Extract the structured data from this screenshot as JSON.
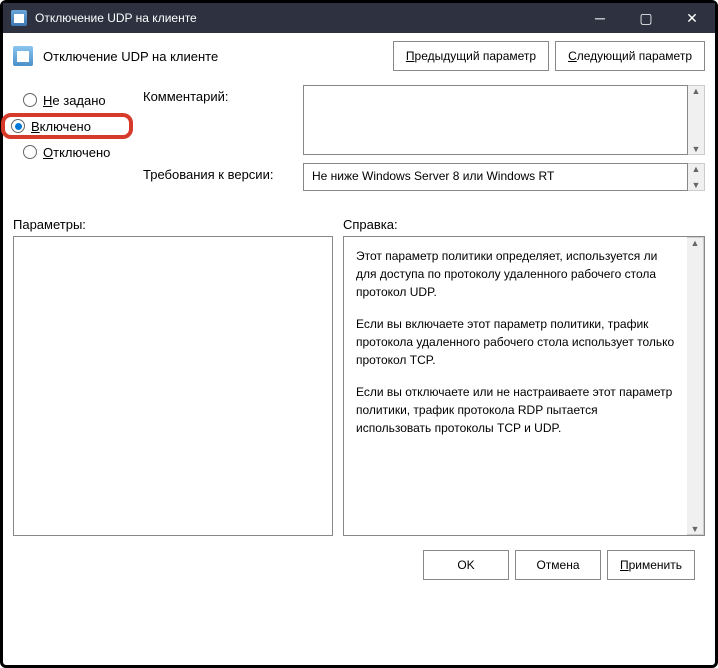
{
  "window": {
    "title": "Отключение UDP на клиенте"
  },
  "header": {
    "title": "Отключение UDP на клиенте",
    "prev_param": "Предыдущий параметр",
    "next_param": "Следующий параметр"
  },
  "radios": {
    "not_configured": "Не задано",
    "enabled": "Включено",
    "disabled": "Отключено",
    "selected": "enabled"
  },
  "fields": {
    "comment_label": "Комментарий:",
    "comment_value": "",
    "requirements_label": "Требования к версии:",
    "requirements_value": "Не ниже Windows Server 8 или Windows RT"
  },
  "panes": {
    "params_label": "Параметры:",
    "help_label": "Справка:",
    "help_paragraphs": [
      "Этот параметр политики определяет, используется ли для доступа по протоколу удаленного рабочего стола протокол UDP.",
      "Если вы включаете этот параметр политики, трафик протокола удаленного рабочего стола использует только протокол TCP.",
      "Если вы отключаете или не настраиваете этот параметр политики, трафик протокола RDP пытается использовать протоколы TCP и UDP."
    ]
  },
  "footer": {
    "ok": "OK",
    "cancel": "Отмена",
    "apply": "Применить"
  }
}
